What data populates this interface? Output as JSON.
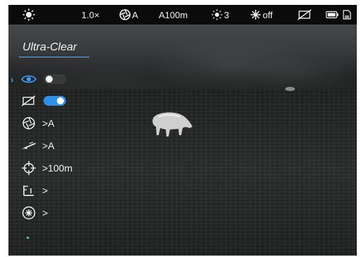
{
  "topbar": {
    "brightness_icon": "sun-icon",
    "zoom": "1.0×",
    "calibration_icon": "aperture-icon",
    "calibration_mode": "A",
    "rangefinder": "A100m",
    "contrast_icon": "sun-small-icon",
    "contrast_value": "3",
    "illuminator_icon": "star-burst-icon",
    "illuminator_state": "off",
    "pip_icon": "screen-off-icon",
    "battery_icon": "battery-icon",
    "storage_icon": "sd-card-icon"
  },
  "menu": {
    "title": "Ultra-Clear",
    "items": [
      {
        "icon": "eye-icon",
        "type": "toggle",
        "state": "off",
        "selected": true
      },
      {
        "icon": "display-off-icon",
        "type": "toggle",
        "state": "on",
        "selected": false
      },
      {
        "icon": "aperture-icon",
        "value": ">A"
      },
      {
        "icon": "rifle-icon",
        "value": ">A"
      },
      {
        "icon": "crosshair-icon",
        "value": ">100m"
      },
      {
        "icon": "ruler-icon",
        "value": ">"
      },
      {
        "icon": "settings-burst-icon",
        "value": ">"
      }
    ],
    "selector": "›"
  },
  "colors": {
    "accent": "#3fa0ff",
    "toggle_on": "#2f8fe8",
    "text": "#f2f2f2",
    "indicator": "#27d3c3"
  }
}
